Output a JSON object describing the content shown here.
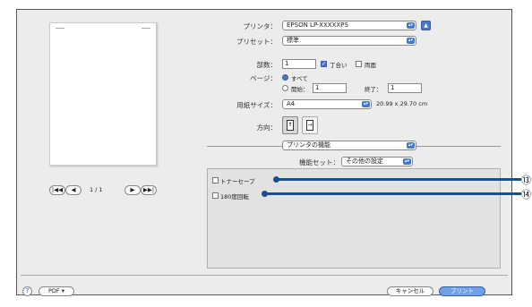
{
  "printer": {
    "label": "プリンタ：",
    "value": "EPSON LP-XXXXXPS"
  },
  "preset": {
    "label": "プリセット：",
    "value": "標準"
  },
  "copies": {
    "label": "部数：",
    "value": "1",
    "collate_label": "丁合い",
    "collate_checked": true,
    "duplex_label": "両面",
    "duplex_checked": false
  },
  "pages": {
    "label": "ページ：",
    "all_label": "すべて",
    "from_label": "開始：",
    "from_value": "1",
    "to_label": "終了：",
    "to_value": "1",
    "selected": "all"
  },
  "paper": {
    "label": "用紙サイズ：",
    "value": "A4",
    "dimensions": "20.99 x 29.70 cm"
  },
  "orientation": {
    "label": "方向："
  },
  "section_popup": {
    "value": "プリンタの機能"
  },
  "feature_set": {
    "label": "機能セット：",
    "value": "その他の設定"
  },
  "options": [
    {
      "label": "トナーセーブ",
      "checked": false,
      "callout": "⑬"
    },
    {
      "label": "180度回転",
      "checked": false,
      "callout": "⑭"
    }
  ],
  "preview_nav": {
    "first": "|◀◀",
    "prev": "◀",
    "page_indicator": "1 / 1",
    "next": "▶",
    "last": "▶▶|"
  },
  "help_icon": "?",
  "pdf_button": "PDF ▾",
  "cancel_button": "キャンセル",
  "print_button": "プリント",
  "colors": {
    "accent": "#4a78c8",
    "callout_line": "#1a4f8f"
  }
}
